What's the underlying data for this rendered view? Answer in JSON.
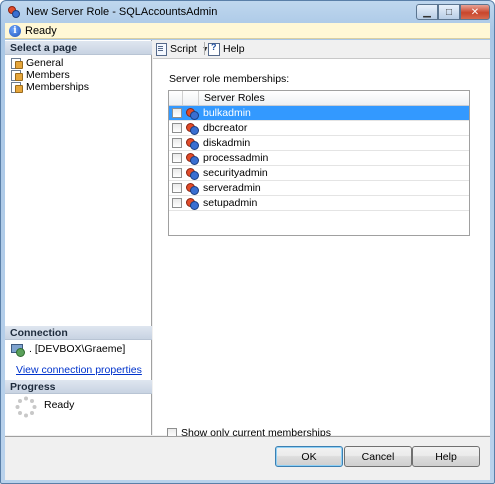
{
  "window": {
    "title": "New Server Role - SQLAccountsAdmin",
    "caption_buttons": {
      "minimize_icon": "minimize-icon",
      "maximize_icon": "maximize-icon",
      "close_icon": "close-icon"
    }
  },
  "status": {
    "icon": "info-icon",
    "text": "Ready"
  },
  "left_pane": {
    "select_page_header": "Select a page",
    "pages": [
      {
        "label": "General",
        "icon": "page-icon"
      },
      {
        "label": "Members",
        "icon": "page-icon"
      },
      {
        "label": "Memberships",
        "icon": "page-icon"
      }
    ],
    "connection_header": "Connection",
    "connection_server": ". [DEVBOX\\Graeme]",
    "connection_link": "View connection properties",
    "progress_header": "Progress",
    "progress_text": "Ready"
  },
  "toolbar": {
    "script_label": "Script",
    "help_label": "Help"
  },
  "content": {
    "section_label": "Server role memberships:",
    "grid_header": "Server Roles",
    "roles": [
      {
        "name": "bulkadmin",
        "checked": false,
        "selected": true
      },
      {
        "name": "dbcreator",
        "checked": false,
        "selected": false
      },
      {
        "name": "diskadmin",
        "checked": false,
        "selected": false
      },
      {
        "name": "processadmin",
        "checked": false,
        "selected": false
      },
      {
        "name": "securityadmin",
        "checked": false,
        "selected": false
      },
      {
        "name": "serveradmin",
        "checked": false,
        "selected": false
      },
      {
        "name": "setupadmin",
        "checked": false,
        "selected": false
      }
    ],
    "show_only_label": "Show only current memberships"
  },
  "footer": {
    "ok_label": "OK",
    "cancel_label": "Cancel",
    "help_label": "Help"
  },
  "colors": {
    "selection": "#3399ff",
    "link": "#0033cc",
    "status_background": "#fff8d6"
  }
}
